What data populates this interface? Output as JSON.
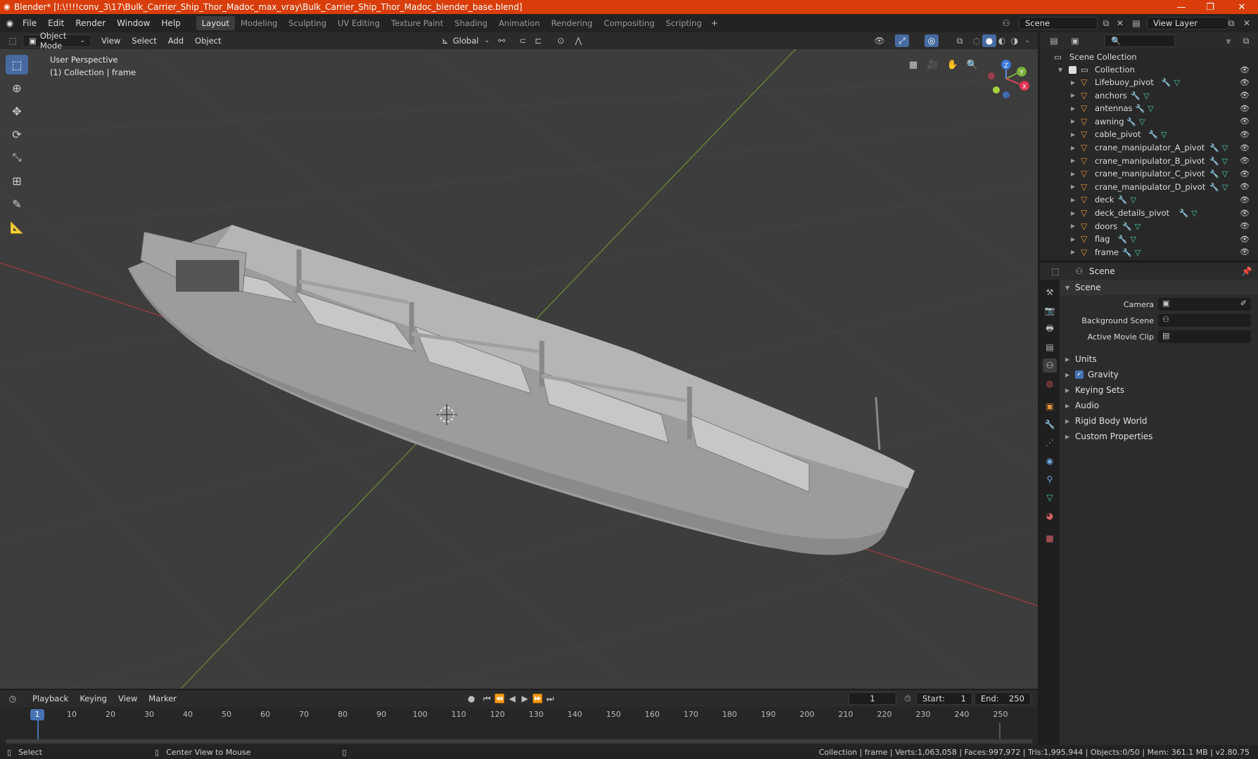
{
  "titlebar": {
    "title": "Blender* [I:\\!!!!conv_3\\17\\Bulk_Carrier_Ship_Thor_Madoc_max_vray\\Bulk_Carrier_Ship_Thor_Madoc_blender_base.blend]"
  },
  "menu": {
    "items": [
      "File",
      "Edit",
      "Render",
      "Window",
      "Help"
    ]
  },
  "workspaces": [
    "Layout",
    "Modeling",
    "Sculpting",
    "UV Editing",
    "Texture Paint",
    "Shading",
    "Animation",
    "Rendering",
    "Compositing",
    "Scripting"
  ],
  "scene_selector": "Scene",
  "view_layer": "View Layer",
  "viewport_header": {
    "mode": "Object Mode",
    "menus": [
      "View",
      "Select",
      "Add",
      "Object"
    ],
    "orientation": "Global"
  },
  "viewport": {
    "perspective": "User Perspective",
    "collection_info": "(1) Collection | frame",
    "axes": {
      "x": "X",
      "y": "Y",
      "z": "Z"
    }
  },
  "outliner": {
    "root": "Scene Collection",
    "collection": "Collection",
    "items": [
      {
        "name": "Lifebuoy_pivot"
      },
      {
        "name": "anchors"
      },
      {
        "name": "antennas"
      },
      {
        "name": "awning"
      },
      {
        "name": "cable_pivot"
      },
      {
        "name": "crane_manipulator_A_pivot"
      },
      {
        "name": "crane_manipulator_B_pivot"
      },
      {
        "name": "crane_manipulator_C_pivot"
      },
      {
        "name": "crane_manipulator_D_pivot"
      },
      {
        "name": "deck"
      },
      {
        "name": "deck_details_pivot"
      },
      {
        "name": "doors"
      },
      {
        "name": "flag"
      },
      {
        "name": "frame"
      }
    ]
  },
  "properties": {
    "context": "Scene",
    "panel": "Scene",
    "fields": [
      {
        "label": "Camera"
      },
      {
        "label": "Background Scene"
      },
      {
        "label": "Active Movie Clip"
      }
    ],
    "subpanels": [
      "Units",
      "Gravity",
      "Keying Sets",
      "Audio",
      "Rigid Body World",
      "Custom Properties"
    ]
  },
  "timeline": {
    "menus": [
      "Playback",
      "Keying",
      "View",
      "Marker"
    ],
    "current_frame": "1",
    "start_label": "Start:",
    "start": "1",
    "end_label": "End:",
    "end": "250",
    "ticks": [
      "10",
      "20",
      "30",
      "40",
      "50",
      "60",
      "70",
      "80",
      "90",
      "100",
      "110",
      "120",
      "130",
      "140",
      "150",
      "160",
      "170",
      "180",
      "190",
      "200",
      "210",
      "220",
      "230",
      "240",
      "250"
    ]
  },
  "statusbar": {
    "select": "Select",
    "center": "Center View to Mouse",
    "stats": "Collection | frame | Verts:1,063,058 | Faces:997,972 | Tris:1,995,944 | Objects:0/50 | Mem: 361.1 MB | v2.80.75"
  }
}
